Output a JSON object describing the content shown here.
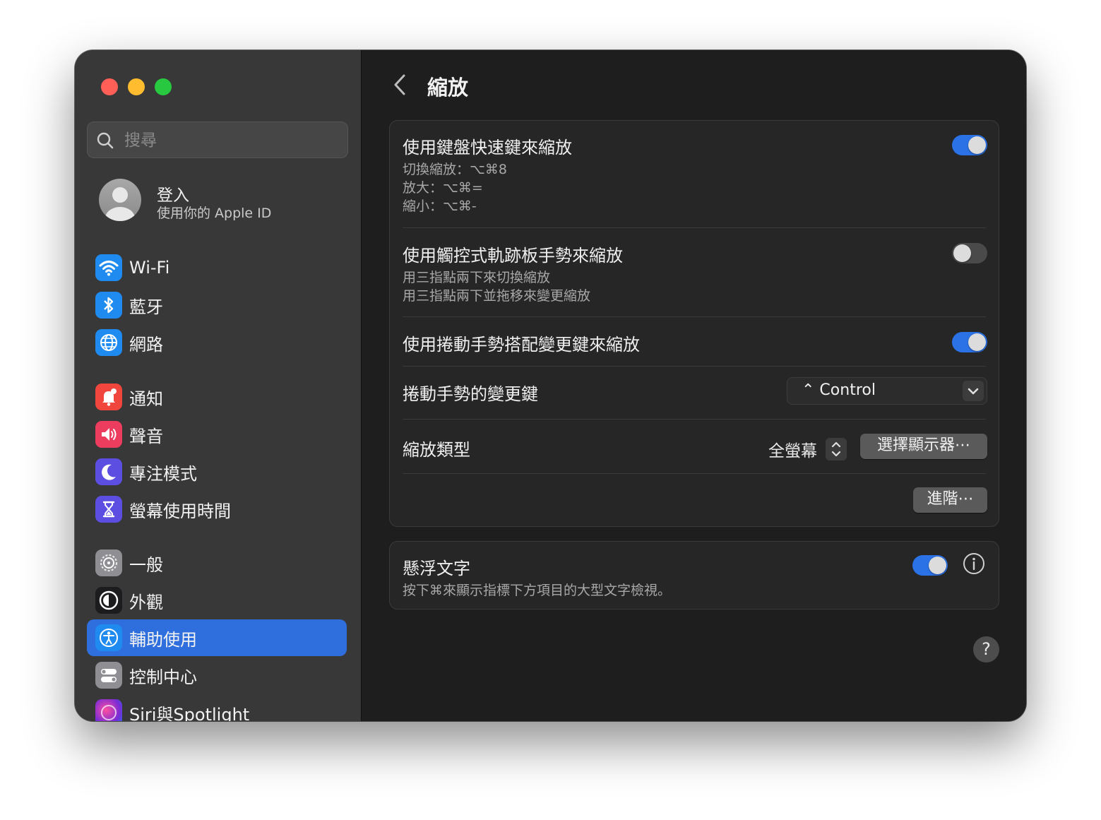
{
  "search": {
    "placeholder": "搜尋"
  },
  "account": {
    "name": "登入",
    "subtitle": "使用你的 Apple ID"
  },
  "sidebar": {
    "items": [
      {
        "label": "Wi-Fi",
        "icon": "wifi-icon",
        "color": "#1f8bf0"
      },
      {
        "label": "藍牙",
        "icon": "bluetooth-icon",
        "color": "#1f8bf0"
      },
      {
        "label": "網路",
        "icon": "globe-icon",
        "color": "#1f8bf0"
      },
      {
        "label": "通知",
        "icon": "bell-icon",
        "color": "#f0463e"
      },
      {
        "label": "聲音",
        "icon": "speaker-icon",
        "color": "#ec3d5f"
      },
      {
        "label": "專注模式",
        "icon": "moon-icon",
        "color": "#5b4ee0"
      },
      {
        "label": "螢幕使用時間",
        "icon": "hourglass-icon",
        "color": "#5b4ee0"
      },
      {
        "label": "一般",
        "icon": "gear-icon",
        "color": "#8e8e93"
      },
      {
        "label": "外觀",
        "icon": "appearance-icon",
        "color": "#1c1c1e"
      },
      {
        "label": "輔助使用",
        "icon": "accessibility-icon",
        "color": "#1f8bf0",
        "active": true
      },
      {
        "label": "控制中心",
        "icon": "control-center-icon",
        "color": "#8e8e93"
      },
      {
        "label": "Siri與Spotlight",
        "icon": "siri-icon",
        "color": "#a03ad0"
      }
    ]
  },
  "header": {
    "title": "縮放"
  },
  "zoom": {
    "keyboard": {
      "title": "使用鍵盤快速鍵來縮放",
      "line1": "切換縮放：⌥⌘8",
      "line2": "放大：⌥⌘=",
      "line3": "縮小：⌥⌘-",
      "enabled": true
    },
    "trackpad": {
      "title": "使用觸控式軌跡板手勢來縮放",
      "line1": "用三指點兩下來切換縮放",
      "line2": "用三指點兩下並拖移來變更縮放",
      "enabled": false
    },
    "scroll": {
      "title": "使用捲動手勢搭配變更鍵來縮放",
      "enabled": true
    },
    "modifier": {
      "title": "捲動手勢的變更鍵",
      "value": "⌃ Control"
    },
    "type": {
      "title": "縮放類型",
      "value": "全螢幕",
      "choose_display": "選擇顯示器⋯"
    },
    "advanced": "進階⋯"
  },
  "hover_text": {
    "title": "懸浮文字",
    "desc": "按下⌘來顯示指標下方項目的大型文字檢視。",
    "enabled": true
  },
  "help": "?",
  "colors": {
    "accent": "#2b72e6",
    "sidebar_bg": "#383838",
    "content_bg": "#1e1e1e"
  }
}
